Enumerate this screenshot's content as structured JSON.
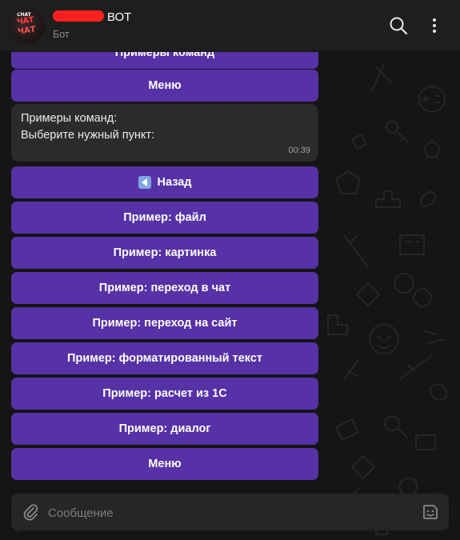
{
  "header": {
    "title": "ВОТ",
    "subtitle": "Бот",
    "avatar_text_top": "CHAT",
    "avatar_text_1": "ЧАТ",
    "avatar_text_2": "ЧАТ",
    "redaction_color": "#ff1f1f"
  },
  "chat": {
    "prev_buttons": [
      {
        "label": "Примеры команд"
      },
      {
        "label": "Меню"
      }
    ],
    "message": {
      "line1": "Примеры команд:",
      "line2": "Выберите нужный пункт:",
      "time": "00:39"
    },
    "back_button": {
      "label": "Назад",
      "icon": "back-arrow-icon"
    },
    "buttons": [
      {
        "label": "Пример: файл"
      },
      {
        "label": "Пример: картинка"
      },
      {
        "label": "Пример: переход в чат"
      },
      {
        "label": "Пример: переход на сайт"
      },
      {
        "label": "Пример: форматированный текст"
      },
      {
        "label": "Пример: расчет из 1С"
      },
      {
        "label": "Пример: диалог"
      },
      {
        "label": "Меню"
      }
    ]
  },
  "composer": {
    "placeholder": "Сообщение",
    "attach_icon": "paperclip-icon",
    "sticker_icon": "sticker-icon"
  },
  "colors": {
    "button": "#5632a6",
    "bubble": "#2b2b2b",
    "background": "#151515"
  }
}
